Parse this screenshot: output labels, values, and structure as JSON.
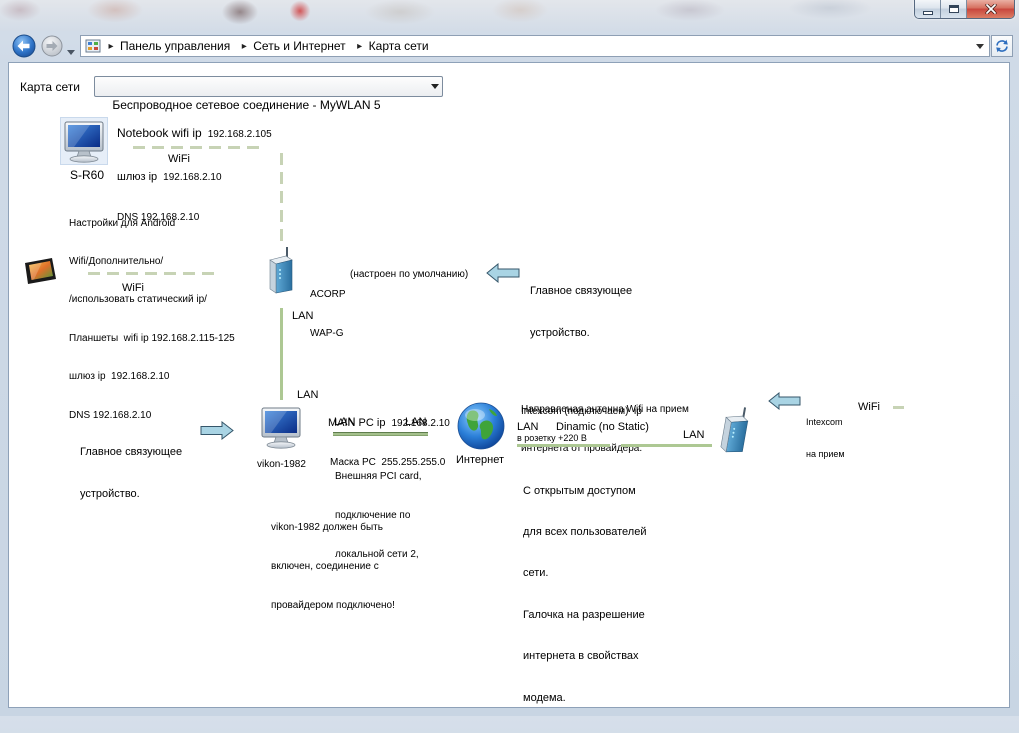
{
  "address_bar": {
    "separator": "▸",
    "breadcrumbs": [
      "Панель управления",
      "Сеть и Интернет",
      "Карта сети"
    ]
  },
  "header": {
    "label": "Карта сети",
    "connection_select": "Беспроводное сетевое соединение - MyWLAN 5"
  },
  "map": {
    "notebook": {
      "name": "S-R60",
      "ip": {
        "label": "Notebook wifi ip",
        "value": "192.168.2.105"
      },
      "gateway": {
        "label": "шлюз ip",
        "value": "192.168.2.10"
      },
      "dns": "DNS 192.168.2.10",
      "link_label": "WiFi"
    },
    "tablets": {
      "note": [
        "Настройки для Android",
        "Wifi/Дополнительно/",
        "/использовать статический ip/",
        "Планшеты  wifi ip 192.168.2.115-125",
        "шлюз ip  192.168.2.10",
        "DNS 192.168.2.10"
      ],
      "link_label": "WiFi"
    },
    "router": {
      "name": [
        "ACORP",
        "WAP-G"
      ],
      "status": "(настроен по умолчанию)",
      "callout": [
        "Главное связующее",
        "устройство."
      ],
      "uplink_label": "LAN"
    },
    "main_pc": {
      "name": "vikon-1982",
      "lan_label": "LAN",
      "ip": {
        "label": "MAIN PC ip",
        "value": "192.168.2.10"
      },
      "mask": "Маска PC  255.255.255.0",
      "link_labels": [
        "LAN",
        "LAN"
      ],
      "card_note": [
        "Внешняя PCI card,",
        "подключение по",
        "локальной сети 2,"
      ],
      "requirement_note": [
        "vikon-1982 должен быть",
        "включен, соединение с",
        "провайдером подключено!"
      ],
      "callout": [
        "Главное связующее",
        "устройство."
      ]
    },
    "internet": {
      "name": "Интернет",
      "sharing_note": [
        "С открытым доступом",
        "для всех пользователей",
        "сети.",
        "Галочка на разрешение",
        "интернета в свойствах",
        "модема."
      ]
    },
    "modem": {
      "antenna_note": [
        "Направленая антенна Wifi на прием",
        "интернета от провайдера."
      ],
      "connection": "Intexcom (подключаем)  ip",
      "left_lan_label": "LAN",
      "ip_mode": "Dinamic (no Static)",
      "power": "в розетку +220 В",
      "right_lan_label": "LAN",
      "callout": [
        "Intexcom",
        "на прием"
      ],
      "link_label": "WiFi"
    }
  },
  "icons": [
    "back-arrow-icon",
    "forward-arrow-icon",
    "control-panel-icon",
    "refresh-icon",
    "computer-icon",
    "tablet-icon",
    "router-icon",
    "globe-icon",
    "callout-arrow-icon"
  ],
  "colors": {
    "link_dashed": "#c7d3b5",
    "link_solid": "#adc893",
    "callout_arrow": "#a9d4e4",
    "close_button": "#c9463d"
  }
}
